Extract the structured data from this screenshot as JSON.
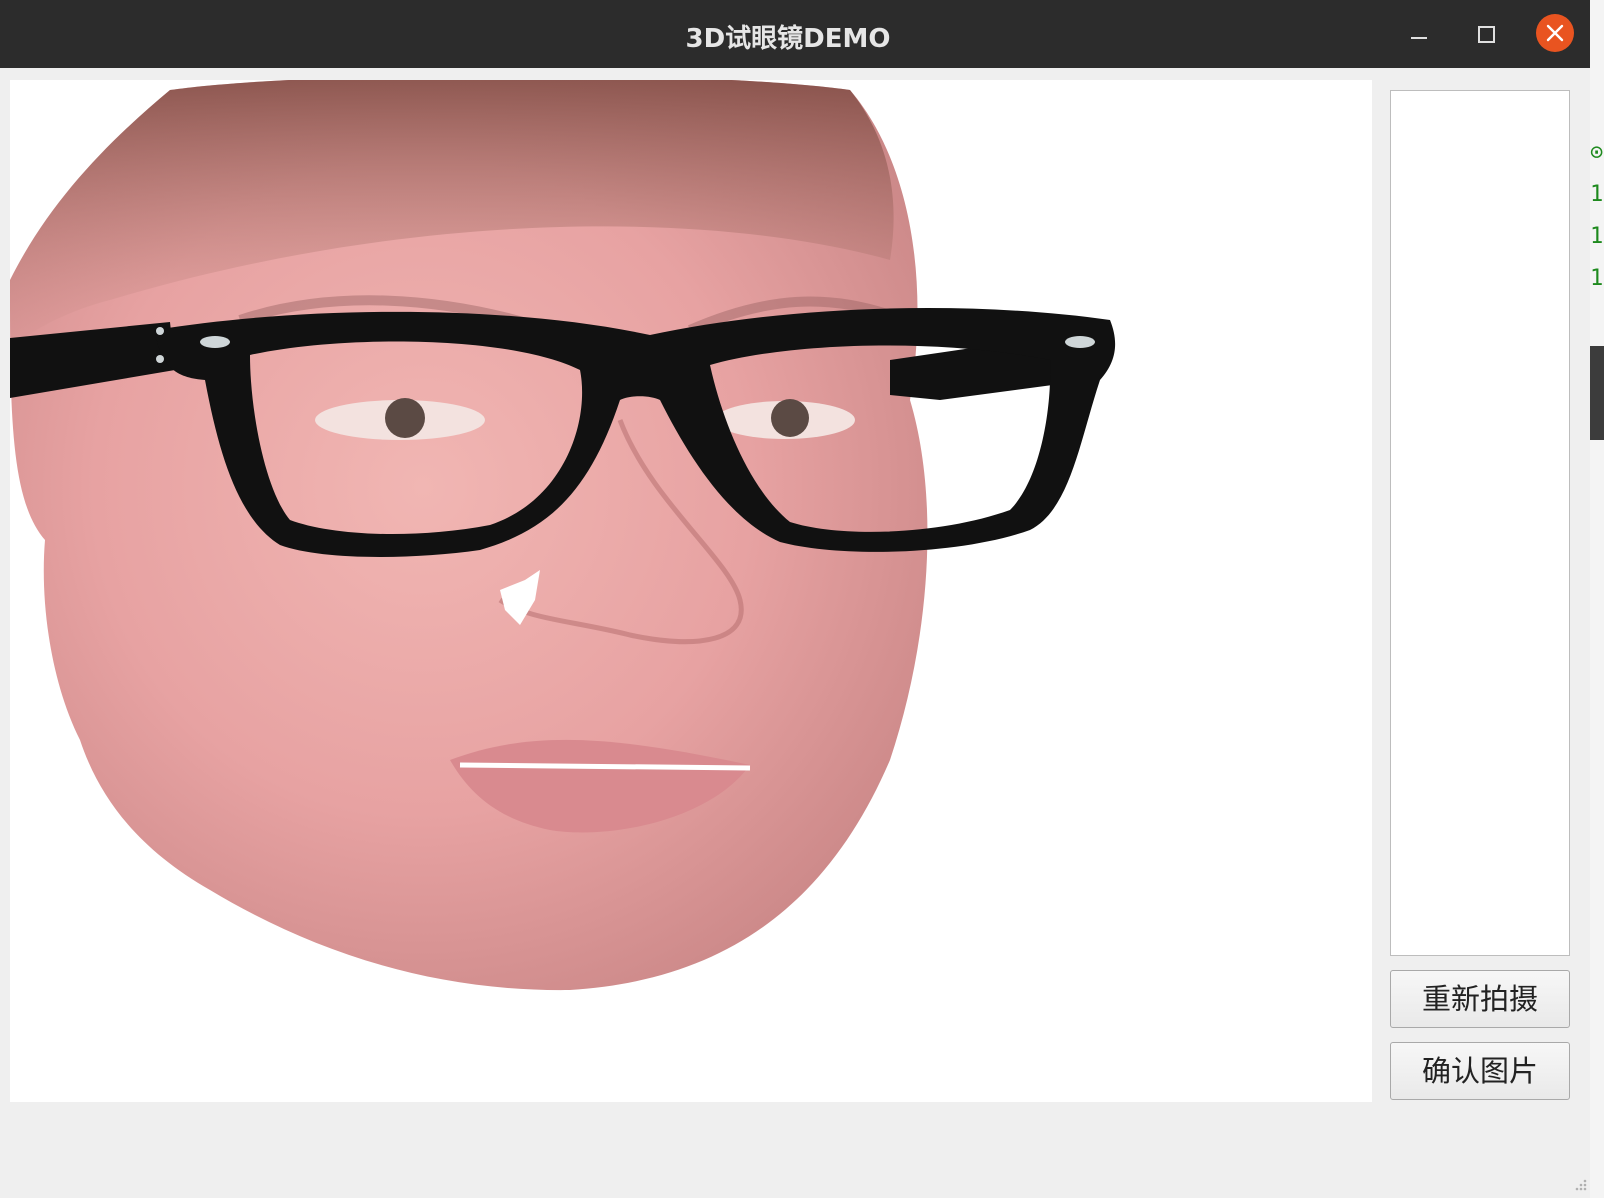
{
  "window": {
    "title": "3D试眼镜DEMO",
    "accent_close_color": "#e95420",
    "titlebar_color": "#2c2c2c"
  },
  "controls": {
    "retake_label": "重新拍摄",
    "confirm_label": "确认图片"
  },
  "background_terminal": {
    "glyphs": [
      "⊙",
      "1",
      "1",
      "1"
    ],
    "glyph_color": "#1e8a1e"
  },
  "preview": {
    "content": "3d-face-with-glasses-render",
    "skin_color": "#e8a6a6",
    "frame_color": "#111111"
  },
  "icons": [
    "minimize-icon",
    "maximize-icon",
    "close-icon",
    "resize-grip-icon"
  ]
}
